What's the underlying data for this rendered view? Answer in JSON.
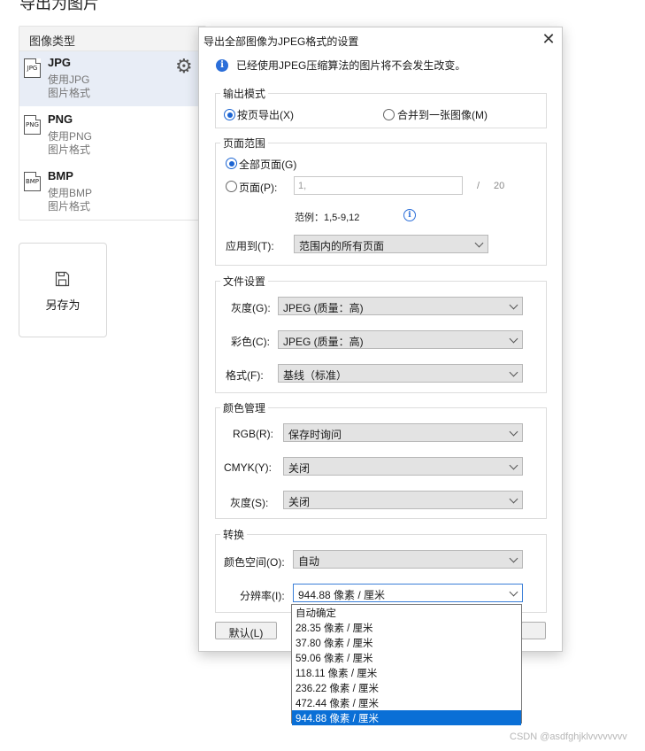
{
  "page": {
    "title": "导出为图片",
    "type_panel_header": "图像类型",
    "image_types": [
      {
        "icon_text": "JPG",
        "name": "JPG",
        "desc1": "使用JPG",
        "desc2": "图片格式",
        "selected": true
      },
      {
        "icon_text": "PNG",
        "name": "PNG",
        "desc1": "使用PNG",
        "desc2": "图片格式",
        "selected": false
      },
      {
        "icon_text": "BMP",
        "name": "BMP",
        "desc1": "使用BMP",
        "desc2": "图片格式",
        "selected": false
      }
    ],
    "save_as_label": "另存为"
  },
  "dialog": {
    "title": "导出全部图像为JPEG格式的设置",
    "info": "已经使用JPEG压缩算法的图片将不会发生改变。",
    "output_mode": {
      "title": "输出模式",
      "option_by_page": "按页导出(X)",
      "option_merge": "合并到一张图像(M)"
    },
    "page_range": {
      "title": "页面范围",
      "all_pages": "全部页面(G)",
      "pages": "页面(P):",
      "pages_value": "1,",
      "slash": "/",
      "total": "20",
      "example": "范例：1,5-9,12",
      "apply_to_label": "应用到(T):",
      "apply_to_value": "范围内的所有页面"
    },
    "file_settings": {
      "title": "文件设置",
      "gray_label": "灰度(G):",
      "gray_value": "JPEG (质量：高)",
      "color_label": "彩色(C):",
      "color_value": "JPEG (质量：高)",
      "format_label": "格式(F):",
      "format_value": "基线（标准）"
    },
    "color_mgmt": {
      "title": "颜色管理",
      "rgb_label": "RGB(R):",
      "rgb_value": "保存时询问",
      "cmyk_label": "CMYK(Y):",
      "cmyk_value": "关闭",
      "gray_label": "灰度(S):",
      "gray_value": "关闭"
    },
    "conversion": {
      "title": "转换",
      "colorspace_label": "颜色空间(O):",
      "colorspace_value": "自动",
      "resolution_label": "分辨率(I):",
      "resolution_value": "944.88 像素 / 厘米"
    },
    "default_button": "默认(L)"
  },
  "resolution_options": [
    "自动确定",
    "28.35 像素 / 厘米",
    "37.80 像素 / 厘米",
    "59.06 像素 / 厘米",
    "118.11 像素 / 厘米",
    "236.22  像素 / 厘米",
    "472.44 像素 / 厘米",
    "944.88 像素 / 厘米"
  ],
  "selected_resolution_index": 7,
  "watermark": "CSDN @asdfghjklvvvvvvvv",
  "colors": {
    "accent": "#0a6fd6",
    "radio": "#1b64d2",
    "info": "#2b6ed9",
    "selected_row": "#e8edf6"
  }
}
